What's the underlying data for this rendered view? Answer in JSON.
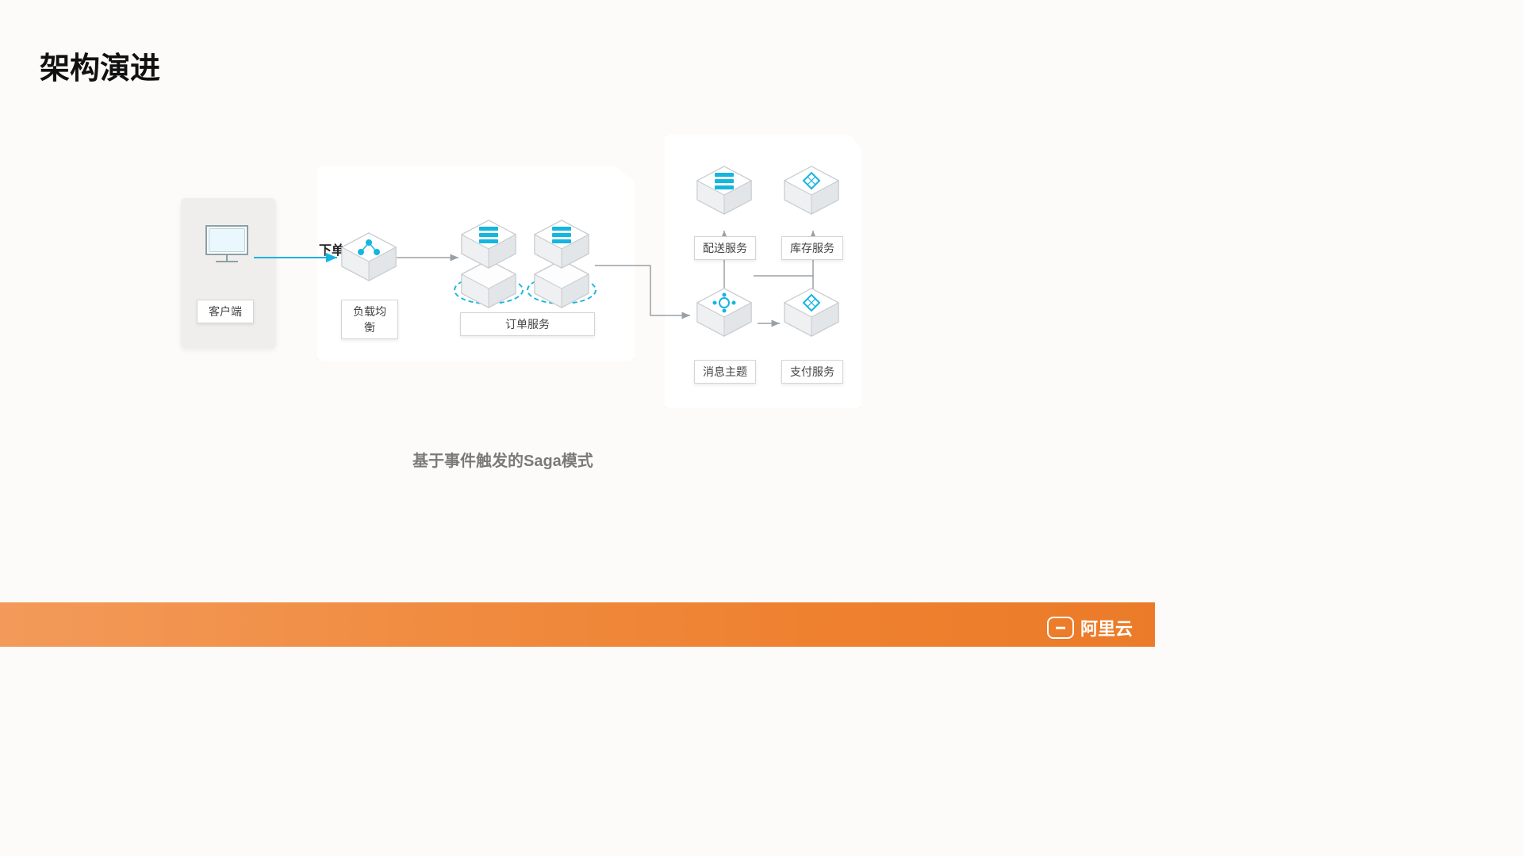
{
  "title": "架构演进",
  "caption": "基于事件触发的Saga模式",
  "footer_brand": "阿里云",
  "arrow_label": "下单",
  "nodes": {
    "client": "客户端",
    "load_balancer": "负载均衡",
    "order_service": "订单服务",
    "delivery_service": "配送服务",
    "inventory_service": "库存服务",
    "message_topic": "消息主题",
    "payment_service": "支付服务"
  },
  "colors": {
    "accent_blue": "#14b5e1",
    "line_gray": "#9aa0a6",
    "footer_orange": "#ee8130"
  }
}
